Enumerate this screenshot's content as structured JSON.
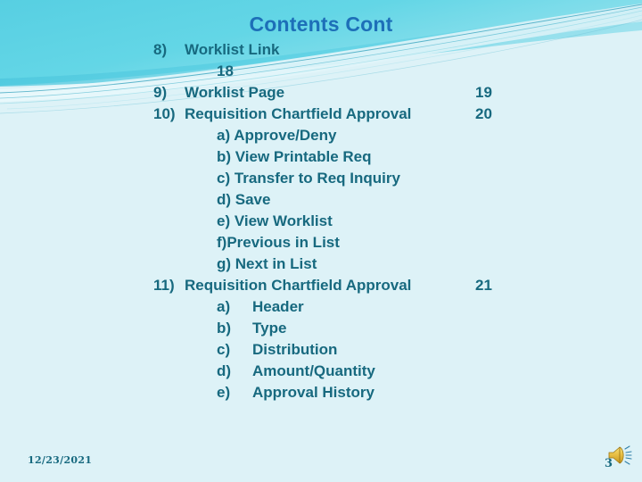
{
  "slide": {
    "title": "Contents Cont",
    "theme": {
      "background": "#ddf2f7",
      "band_teal": "#5fd2e3",
      "band_teal_dark": "#2aa7c4",
      "title_color": "#1d6fb8",
      "body_color": "#17697f",
      "wave_light": "#eaf8fb"
    }
  },
  "contents": {
    "items": [
      {
        "marker": "8)",
        "label": "Worklist Link",
        "page": "",
        "level": 1
      },
      {
        "marker": "",
        "label": "18",
        "page": "",
        "level": "continuation"
      },
      {
        "marker": "9)",
        "label": "Worklist Page",
        "page": "19",
        "level": 1
      },
      {
        "marker": "10)",
        "label": "Requisition Chartfield Approval",
        "page": "20",
        "level": 1
      },
      {
        "marker": "",
        "label": "a) Approve/Deny",
        "page": "",
        "level": 2
      },
      {
        "marker": "",
        "label": "b) View Printable Req",
        "page": "",
        "level": 2
      },
      {
        "marker": "",
        "label": "c) Transfer to Req Inquiry",
        "page": "",
        "level": 2
      },
      {
        "marker": "",
        "label": "d) Save",
        "page": "",
        "level": 2
      },
      {
        "marker": "",
        "label": "e) View Worklist",
        "page": "",
        "level": 2
      },
      {
        "marker": "",
        "label": "f)Previous in List",
        "page": "",
        "level": 2
      },
      {
        "marker": "",
        "label": "g) Next in List",
        "page": "",
        "level": 2
      },
      {
        "marker": "11)",
        "label": "Requisition Chartfield Approval",
        "page": "21",
        "level": 1
      },
      {
        "marker": "a)",
        "label": "Header",
        "page": "",
        "level": "2b"
      },
      {
        "marker": "b)",
        "label": "Type",
        "page": "",
        "level": "2b"
      },
      {
        "marker": "c)",
        "label": "Distribution",
        "page": "",
        "level": "2b"
      },
      {
        "marker": "d)",
        "label": "Amount/Quantity",
        "page": "",
        "level": "2b"
      },
      {
        "marker": "e)",
        "label": "Approval History",
        "page": "",
        "level": "2b"
      }
    ]
  },
  "footer": {
    "date": "12/23/2021",
    "page_number": "3",
    "sound_icon": "speaker-icon"
  }
}
